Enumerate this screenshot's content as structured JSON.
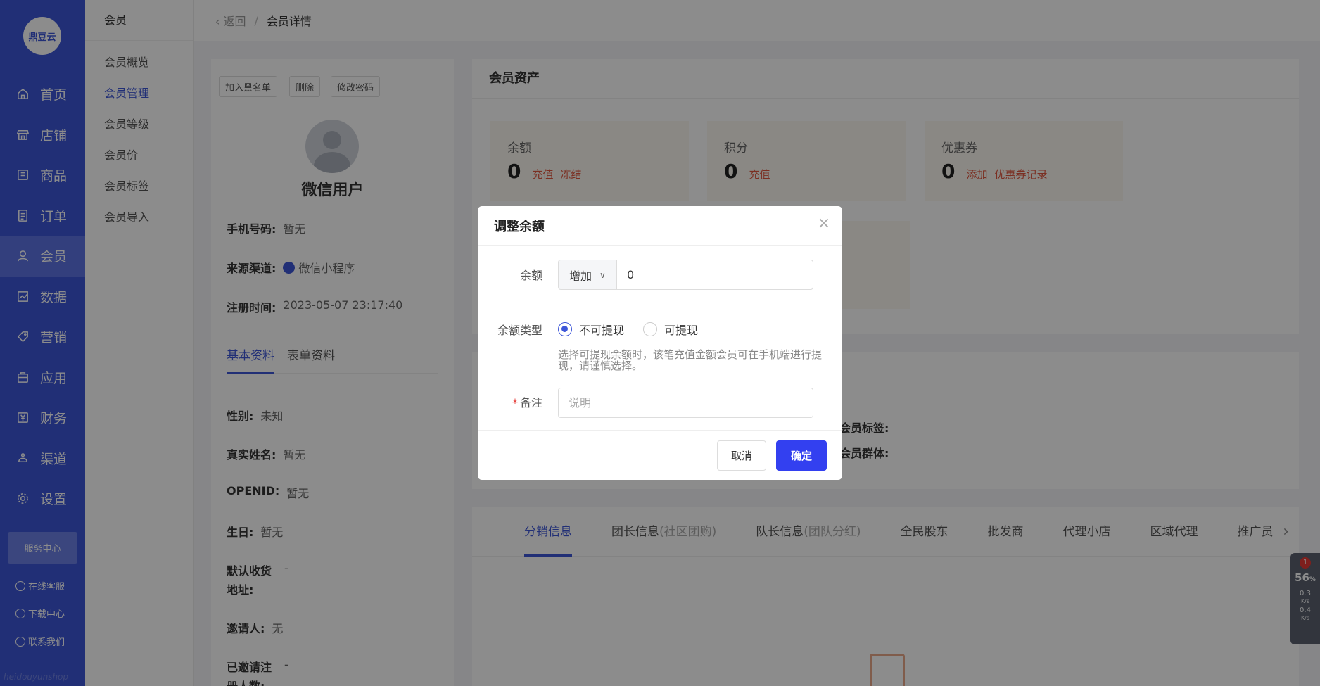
{
  "brand": {
    "logo_text": "鼎豆云",
    "watermark": "heidouyunshop"
  },
  "nav": {
    "items": [
      {
        "label": "首页",
        "icon": "home-icon"
      },
      {
        "label": "店铺",
        "icon": "store-icon"
      },
      {
        "label": "商品",
        "icon": "goods-icon"
      },
      {
        "label": "订单",
        "icon": "order-icon"
      },
      {
        "label": "会员",
        "icon": "member-icon",
        "active": true
      },
      {
        "label": "数据",
        "icon": "data-icon"
      },
      {
        "label": "营销",
        "icon": "tag-icon"
      },
      {
        "label": "应用",
        "icon": "app-icon"
      },
      {
        "label": "财务",
        "icon": "finance-icon"
      },
      {
        "label": "渠道",
        "icon": "channel-icon"
      },
      {
        "label": "设置",
        "icon": "gear-icon"
      }
    ],
    "service_center": "服务中心",
    "online_service": "在线客服",
    "download_center": "下载中心",
    "contact_us": "联系我们"
  },
  "submenu": {
    "title": "会员",
    "items": [
      "会员概览",
      "会员管理",
      "会员等级",
      "会员价",
      "会员标签",
      "会员导入"
    ],
    "active_index": 1
  },
  "breadcrumb": {
    "back": "返回",
    "separator": "/",
    "current": "会员详情"
  },
  "profile": {
    "actions": [
      "加入黑名单",
      "删除",
      "修改密码"
    ],
    "name": "微信用户",
    "phone_label": "手机号码:",
    "phone_value": "暂无",
    "source_label": "来源渠道:",
    "source_value": "微信小程序",
    "register_label": "注册时间:",
    "register_value": "2023-05-07 23:17:40",
    "tabs": [
      "基本资料",
      "表单资料"
    ],
    "fields": [
      {
        "k": "性别:",
        "v": "未知"
      },
      {
        "k": "真实姓名:",
        "v": "暂无"
      },
      {
        "k": "OPENID:",
        "v": "暂无"
      },
      {
        "k": "生日:",
        "v": "暂无"
      },
      {
        "k": "默认收货地址:",
        "v": "-"
      },
      {
        "k": "邀请人:",
        "v": "无"
      },
      {
        "k": "已邀请注册人数:",
        "v": "-"
      }
    ]
  },
  "assets": {
    "title": "会员资产",
    "balance": {
      "label": "余额",
      "value": "0",
      "link1": "充值",
      "link2": "冻结"
    },
    "points": {
      "label": "积分",
      "value": "0",
      "link1": "充值"
    },
    "coupon": {
      "label": "优惠券",
      "value": "0",
      "link1": "添加",
      "link2": "优惠券记录"
    }
  },
  "info2": {
    "tags_label": "会员标签:",
    "group_label": "会员群体:"
  },
  "distribution": {
    "tabs": [
      {
        "label": "分销信息",
        "sub": ""
      },
      {
        "label": "团长信息",
        "sub": "(社区团购)"
      },
      {
        "label": "队长信息",
        "sub": "(团队分红)"
      },
      {
        "label": "全民股东",
        "sub": ""
      },
      {
        "label": "批发商",
        "sub": ""
      },
      {
        "label": "代理小店",
        "sub": ""
      },
      {
        "label": "区域代理",
        "sub": ""
      },
      {
        "label": "推广员",
        "sub": ""
      }
    ]
  },
  "monitor": {
    "badge": "1",
    "percent": "56",
    "percent_unit": "%",
    "up": "0.3",
    "down": "0.4",
    "unit": "K/s"
  },
  "dialog": {
    "title": "调整余额",
    "amount_label": "余额",
    "op_value": "增加",
    "amount_value": "0",
    "type_label": "余额类型",
    "option_non_withdraw": "不可提现",
    "option_withdraw": "可提现",
    "selected_option": "不可提现",
    "hint": "选择可提现余额时，该笔充值金额会员可在手机端进行提现，请谨慎选择。",
    "note_label": "备注",
    "note_placeholder": "说明",
    "cancel": "取消",
    "ok": "确定"
  }
}
